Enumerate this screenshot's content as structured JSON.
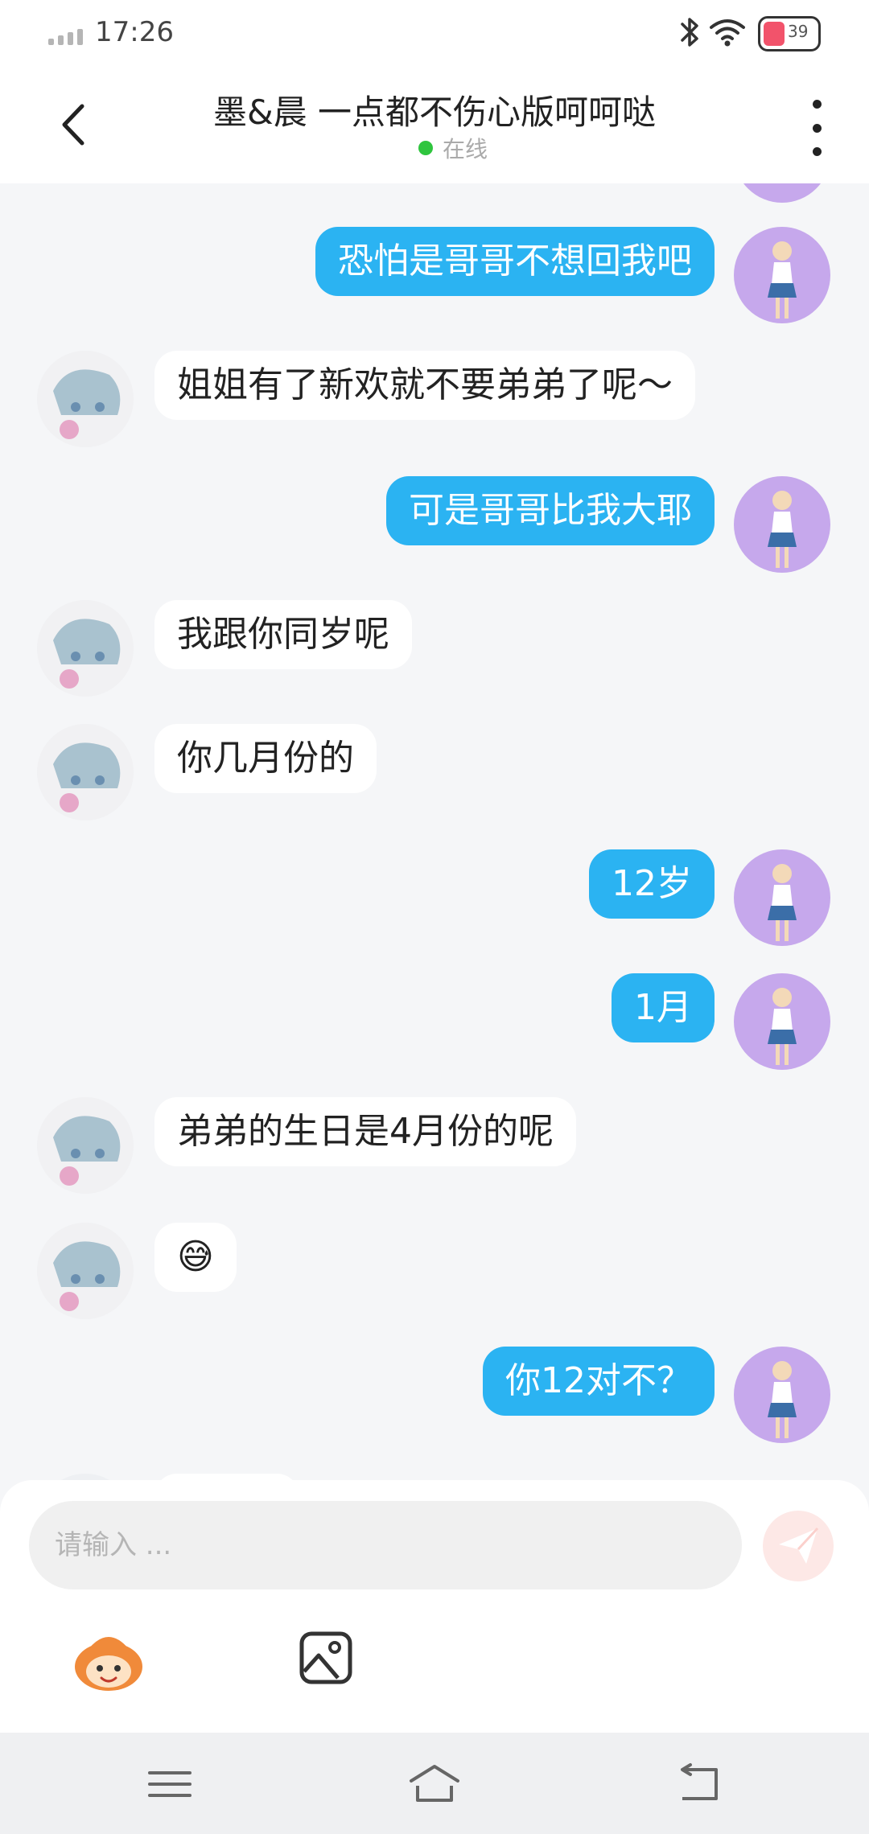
{
  "status_bar": {
    "time": "17:26",
    "battery_level": "39",
    "icons": [
      "signal-icon",
      "bluetooth-icon",
      "wifi-icon",
      "battery-icon"
    ]
  },
  "header": {
    "title": "墨&晨  一点都不伤心版呵呵哒",
    "presence": "在线",
    "presence_color": "#2fc53e"
  },
  "messages": [
    {
      "side": "me",
      "text": "恐怕是哥哥不想回我吧"
    },
    {
      "side": "other",
      "text": "姐姐有了新欢就不要弟弟了呢～"
    },
    {
      "side": "me",
      "text": "可是哥哥比我大耶"
    },
    {
      "side": "other",
      "text": "我跟你同岁呢"
    },
    {
      "side": "other",
      "text": "你几月份的"
    },
    {
      "side": "me",
      "text": "12岁"
    },
    {
      "side": "me",
      "text": "1月"
    },
    {
      "side": "other",
      "text": "弟弟的生日是4月份的呢"
    },
    {
      "side": "other",
      "text": "😅"
    },
    {
      "side": "me",
      "text": "你12对不？"
    }
  ],
  "input": {
    "placeholder": "请输入 ..."
  },
  "toolbar": {
    "items": [
      "emoji-icon",
      "image-icon"
    ]
  },
  "nav_bar": {
    "items": [
      "menu-icon",
      "home-icon",
      "back-icon"
    ]
  },
  "colors": {
    "bubble_me": "#2bb3f2",
    "bubble_other": "#ffffff",
    "background": "#f5f6f8",
    "avatar_me": "#c6a8ec"
  }
}
